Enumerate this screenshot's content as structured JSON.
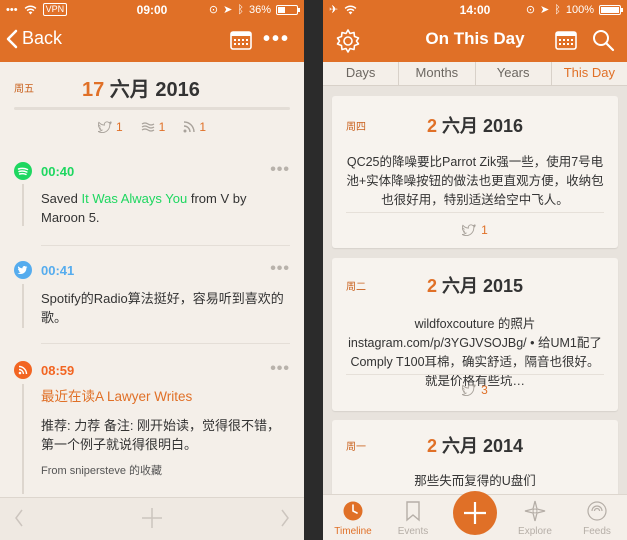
{
  "left": {
    "status": {
      "carrier": "•••",
      "vpn": "VPN",
      "time": "09:00",
      "battery": "36%"
    },
    "nav": {
      "back_label": "Back",
      "more_label": "•••"
    },
    "header": {
      "weekday": "周五",
      "day": "17",
      "month_year": " 六月 2016",
      "counts": {
        "twitter": "1",
        "feed": "1",
        "rss": "1"
      }
    },
    "entries": [
      {
        "time": "00:40",
        "source": "spotify",
        "text_prefix": "Saved ",
        "link": "It Was Always You",
        "text_mid": " from ",
        "text_v": "V",
        "text_suffix": " by Maroon 5."
      },
      {
        "time": "00:41",
        "source": "twitter",
        "text": "Spotify的Radio算法挺好，容易听到喜欢的歌。"
      },
      {
        "time": "08:59",
        "source": "rss",
        "title": "最近在读A Lawyer Writes",
        "text": "推荐: 力荐  备注: 刚开始读，觉得很不错，第一个例子就说得很明白。",
        "from": "From snipersteve 的收藏"
      }
    ],
    "colors": {
      "accent": "#e07027",
      "spotify": "#1ed760",
      "twitter": "#55acee",
      "rss": "#f26522"
    }
  },
  "right": {
    "status": {
      "time": "14:00",
      "battery": "100%"
    },
    "nav": {
      "title": "On This Day"
    },
    "segments": [
      "Days",
      "Months",
      "Years",
      "This Day"
    ],
    "active_segment": "This Day",
    "cards": [
      {
        "weekday": "周四",
        "day": "2",
        "month_year": " 六月 2016",
        "text": "QC25的降噪要比Parrot Zik强一些，使用7号电池+实体降噪按钮的做法也更直观方便，收纳包也很好用，特别适送给空中飞人。",
        "count": "1"
      },
      {
        "weekday": "周二",
        "day": "2",
        "month_year": " 六月 2015",
        "text": "wildfoxcouture 的照片 instagram.com/p/3YGJVSOJBg/ • 给UM1配了Comply T100耳棉，确实舒适，隔音也很好。就是价格有些坑…",
        "count": "3"
      },
      {
        "weekday": "周一",
        "day": "2",
        "month_year": " 六月 2014",
        "text": "那些失而复得的U盘们"
      }
    ],
    "tabs": [
      "Timeline",
      "Events",
      "",
      "Explore",
      "Feeds"
    ],
    "active_tab": "Timeline"
  }
}
